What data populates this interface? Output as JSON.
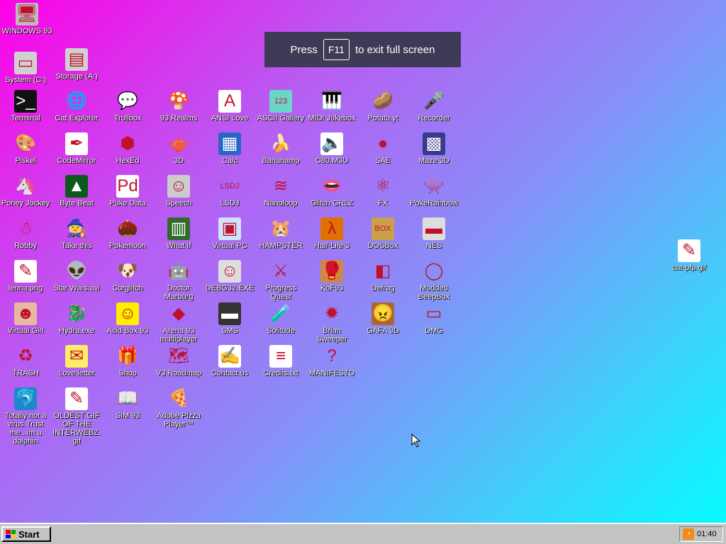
{
  "banner": {
    "press": "Press",
    "key": "F11",
    "suffix": "to exit full screen"
  },
  "taskbar": {
    "start_label": "Start",
    "clock": "01:40"
  },
  "icons": [
    {
      "label": "WINDOWS 93",
      "glyph": "🖥",
      "bg": "#bbbbbb"
    },
    {
      "label": "System (C:)",
      "glyph": "▭",
      "bg": "#d0d0d0"
    },
    {
      "label": "Storage (A:)",
      "glyph": "▤",
      "bg": "#d0d0d0"
    },
    {
      "label": "Terminal",
      "glyph": ">_",
      "bg": "#111111"
    },
    {
      "label": "Cat Explorer",
      "glyph": "🌐",
      "bg": "transparent"
    },
    {
      "label": "Trollbox",
      "glyph": "💬",
      "bg": "transparent"
    },
    {
      "label": "93 Realms",
      "glyph": "🍄",
      "bg": "transparent"
    },
    {
      "label": "ANSI Love",
      "glyph": "A",
      "bg": "#ffffff"
    },
    {
      "label": "ASCII Gallery",
      "glyph": "123",
      "bg": "#6ad6c8"
    },
    {
      "label": "MIDI Jukebox",
      "glyph": "🎹",
      "bg": "transparent"
    },
    {
      "label": "Potato.yt",
      "glyph": "🥔",
      "bg": "transparent"
    },
    {
      "label": "Recorder",
      "glyph": "🎤",
      "bg": "transparent"
    },
    {
      "label": "Piskel",
      "glyph": "🎨",
      "bg": "transparent"
    },
    {
      "label": "CodeMirror",
      "glyph": "✒",
      "bg": "#ffffff"
    },
    {
      "label": "HexEd",
      "glyph": "⬢",
      "bg": "transparent"
    },
    {
      "label": "3D",
      "glyph": "🫖",
      "bg": "transparent"
    },
    {
      "label": "Calc",
      "glyph": "▦",
      "bg": "#2a66c9"
    },
    {
      "label": "Bananamp",
      "glyph": "🍌",
      "bg": "transparent"
    },
    {
      "label": "C80.M3U",
      "glyph": "🔈",
      "bg": "#ffffff"
    },
    {
      "label": "SAE",
      "glyph": "●",
      "bg": "transparent"
    },
    {
      "label": "Maze 3D",
      "glyph": "▩",
      "bg": "#3a3a8a"
    },
    {
      "label": "Poney Jockey",
      "glyph": "🦄",
      "bg": "transparent"
    },
    {
      "label": "Byte Beat",
      "glyph": "▲",
      "bg": "#0b5a1a"
    },
    {
      "label": "Puke Data",
      "glyph": "Pd",
      "bg": "#ffffff"
    },
    {
      "label": "Speech",
      "glyph": "☺",
      "bg": "#cccccc"
    },
    {
      "label": "LSDJ",
      "glyph": "LSDJ",
      "bg": "transparent"
    },
    {
      "label": "Nanoloop",
      "glyph": "≋",
      "bg": "transparent"
    },
    {
      "label": "Glitch GRLZ",
      "glyph": "👄",
      "bg": "transparent"
    },
    {
      "label": "FX",
      "glyph": "⚛",
      "bg": "transparent"
    },
    {
      "label": "PokeRainbow",
      "glyph": "👾",
      "bg": "transparent"
    },
    {
      "label": "Robby",
      "glyph": "☃",
      "bg": "transparent"
    },
    {
      "label": "Take this",
      "glyph": "🧙",
      "bg": "transparent"
    },
    {
      "label": "Pokemoon",
      "glyph": "🌰",
      "bg": "transparent"
    },
    {
      "label": "What If",
      "glyph": "▥",
      "bg": "#2f6a2f"
    },
    {
      "label": "Virtual PC",
      "glyph": "▣",
      "bg": "#cfe3ff"
    },
    {
      "label": "HAMPSTER",
      "glyph": "🐹",
      "bg": "transparent"
    },
    {
      "label": "Half-Life 3",
      "glyph": "λ",
      "bg": "#e07000"
    },
    {
      "label": "DOSBox",
      "glyph": "BOX",
      "bg": "#caa04a"
    },
    {
      "label": "NES",
      "glyph": "▬",
      "bg": "#dddddd"
    },
    {
      "label": "lenna.png",
      "glyph": "✎",
      "bg": "#ffffff"
    },
    {
      "label": "Star Wars.avi",
      "glyph": "👽",
      "bg": "transparent"
    },
    {
      "label": "Corglitch",
      "glyph": "🐶",
      "bg": "transparent"
    },
    {
      "label": "Doctor Marburg",
      "glyph": "🤖",
      "bg": "transparent"
    },
    {
      "label": "DEBG32.EXE",
      "glyph": "☺",
      "bg": "#dddddd"
    },
    {
      "label": "Progress Quest",
      "glyph": "⚔",
      "bg": "transparent"
    },
    {
      "label": "KoF93",
      "glyph": "🥊",
      "bg": "#cc8844"
    },
    {
      "label": "Defrag",
      "glyph": "◧",
      "bg": "transparent"
    },
    {
      "label": "Modded BeepBox",
      "glyph": "◯",
      "bg": "transparent"
    },
    {
      "label": "Virtual Girl",
      "glyph": "☻",
      "bg": "#e8b8a0"
    },
    {
      "label": "Hydra.exe",
      "glyph": "🐉",
      "bg": "transparent"
    },
    {
      "label": "Acid Box 93",
      "glyph": "☺",
      "bg": "#ffee00"
    },
    {
      "label": "Arena 93 multiplayer",
      "glyph": "◆",
      "bg": "transparent"
    },
    {
      "label": "SMS",
      "glyph": "▬",
      "bg": "#333333"
    },
    {
      "label": "Solitude",
      "glyph": "🧪",
      "bg": "transparent"
    },
    {
      "label": "Brian Sweeper",
      "glyph": "✹",
      "bg": "transparent"
    },
    {
      "label": "GAFA 3D",
      "glyph": "😠",
      "bg": "#aa6633"
    },
    {
      "label": "DMG",
      "glyph": "▭",
      "bg": "transparent"
    },
    {
      "label": "TRASH",
      "glyph": "♻",
      "bg": "transparent"
    },
    {
      "label": "Love letter",
      "glyph": "✉",
      "bg": "#ffee66"
    },
    {
      "label": "Shop",
      "glyph": "🎁",
      "bg": "transparent"
    },
    {
      "label": "V3 Roadmap",
      "glyph": "🗺",
      "bg": "transparent"
    },
    {
      "label": "Contact us",
      "glyph": "✍",
      "bg": "#ffffff"
    },
    {
      "label": "Credits.txt",
      "glyph": "≡",
      "bg": "#ffffff"
    },
    {
      "label": "MANIFESTO",
      "glyph": "?",
      "bg": "transparent"
    },
    {
      "label": "Totally not a virus.Trust me...im a dolphin",
      "glyph": "🐬",
      "bg": "#1e88c8"
    },
    {
      "label": "OLDEST GIF OF THE INTERWEBZ.gif",
      "glyph": "✎",
      "bg": "#ffffff"
    },
    {
      "label": "SIM 93",
      "glyph": "📖",
      "bg": "transparent"
    },
    {
      "label": "Adobe Pizza Player™",
      "glyph": "🍕",
      "bg": "transparent"
    },
    {
      "label": "cat-pfp.gif",
      "glyph": "✎",
      "bg": "#ffffff"
    }
  ]
}
